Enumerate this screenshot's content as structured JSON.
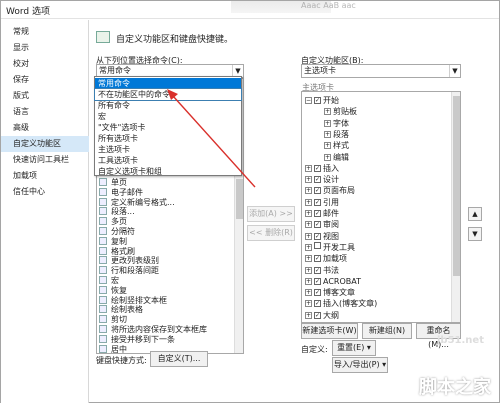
{
  "window": {
    "title": "Word 选项",
    "blur_text": "Aaac  AaB  aac"
  },
  "sidebar": {
    "items": [
      {
        "label": "常规"
      },
      {
        "label": "显示"
      },
      {
        "label": "校对"
      },
      {
        "label": "保存"
      },
      {
        "label": "版式"
      },
      {
        "label": "语言"
      },
      {
        "label": "高级"
      },
      {
        "label": "自定义功能区"
      },
      {
        "label": "快速访问工具栏"
      },
      {
        "label": "加载项"
      },
      {
        "label": "信任中心"
      }
    ],
    "selected": "自定义功能区"
  },
  "header": {
    "title": "自定义功能区和键盘快捷键。"
  },
  "left": {
    "label": "从下列位置选择命令(C):",
    "combo_value": "常用命令",
    "dropdown": [
      "常用命令",
      "不在功能区中的命令",
      "所有命令",
      "宏",
      "\"文件\"选项卡",
      "所有选项卡",
      "主选项卡",
      "工具选项卡",
      "自定义选项卡和组"
    ],
    "commands": [
      "单页",
      "电子邮件",
      "定义新编号格式...",
      "段落...",
      "多页",
      "分隔符",
      "复制",
      "格式刷",
      "更改列表级别",
      "行和段落间距",
      "宏",
      "恢复",
      "绘制竖排文本框",
      "绘制表格",
      "剪切",
      "将所选内容保存到文本框库",
      "接受并移到下一条",
      "居中"
    ],
    "keyboard_label": "键盘快捷方式:",
    "keyboard_button": "自定义(T)..."
  },
  "middle": {
    "add_label": "添加(A) >>",
    "remove_label": "<< 删除(R)"
  },
  "right": {
    "label": "自定义功能区(B):",
    "combo_value": "主选项卡",
    "tree_header": "主选项卡",
    "tree": [
      {
        "label": "开始",
        "level": 0,
        "exp": "⊟",
        "cb": true
      },
      {
        "label": "剪贴板",
        "level": 1,
        "exp": "⊞",
        "cb": false
      },
      {
        "label": "字体",
        "level": 1,
        "exp": "⊞",
        "cb": false
      },
      {
        "label": "段落",
        "level": 1,
        "exp": "⊞",
        "cb": false
      },
      {
        "label": "样式",
        "level": 1,
        "exp": "⊞",
        "cb": false
      },
      {
        "label": "编辑",
        "level": 1,
        "exp": "⊞",
        "cb": false
      },
      {
        "label": "插入",
        "level": 0,
        "exp": "⊞",
        "cb": true
      },
      {
        "label": "设计",
        "level": 0,
        "exp": "⊞",
        "cb": true
      },
      {
        "label": "页面布局",
        "level": 0,
        "exp": "⊞",
        "cb": true
      },
      {
        "label": "引用",
        "level": 0,
        "exp": "⊞",
        "cb": true
      },
      {
        "label": "邮件",
        "level": 0,
        "exp": "⊞",
        "cb": true
      },
      {
        "label": "审阅",
        "level": 0,
        "exp": "⊞",
        "cb": true
      },
      {
        "label": "视图",
        "level": 0,
        "exp": "⊞",
        "cb": true
      },
      {
        "label": "开发工具",
        "level": 0,
        "exp": "⊞",
        "cb": false
      },
      {
        "label": "加载项",
        "level": 0,
        "exp": "⊞",
        "cb": true
      },
      {
        "label": "书法",
        "level": 0,
        "exp": "⊞",
        "cb": true
      },
      {
        "label": "ACROBAT",
        "level": 0,
        "exp": "⊞",
        "cb": true
      },
      {
        "label": "博客文章",
        "level": 0,
        "exp": "⊞",
        "cb": true
      },
      {
        "label": "插入(博客文章)",
        "level": 0,
        "exp": "⊞",
        "cb": true
      },
      {
        "label": "大纲",
        "level": 0,
        "exp": "⊞",
        "cb": true
      }
    ],
    "new_tab": "新建选项卡(W)",
    "new_group": "新建组(N)",
    "rename": "重命名(M)...",
    "customize_label": "自定义:",
    "reset": "重置(E) ▾",
    "import_export": "导入/导出(P) ▾"
  },
  "watermark": {
    "site": "jb51.net",
    "name": "脚本之家"
  },
  "colors": {
    "selection": "#0078d7",
    "sidebar_selected": "#d5e8f8",
    "arrow": "#d9302b"
  }
}
